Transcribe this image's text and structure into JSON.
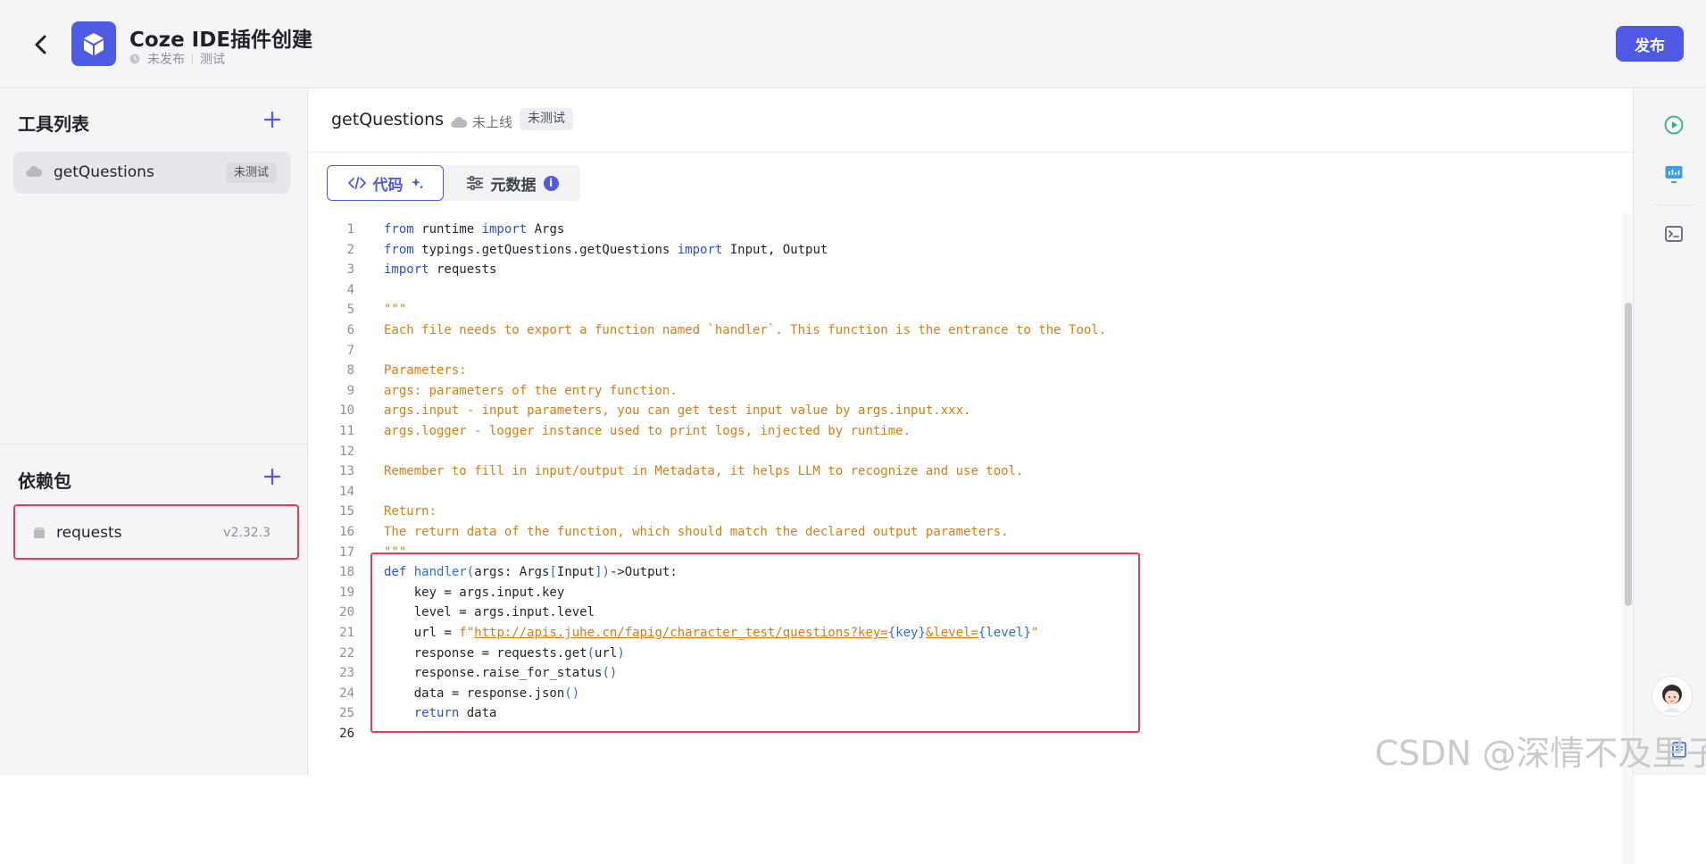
{
  "header": {
    "app_title": "Coze IDE插件创建",
    "status": "未发布",
    "mode": "测试",
    "publish_label": "发布"
  },
  "sidebar": {
    "tools_title": "工具列表",
    "tools": [
      {
        "name": "getQuestions",
        "badge": "未测试"
      }
    ],
    "deps_title": "依赖包",
    "deps": [
      {
        "name": "requests",
        "version": "v2.32.3"
      }
    ]
  },
  "editor": {
    "file_name": "getQuestions",
    "file_status": "未上线",
    "file_badge": "未测试",
    "tabs": {
      "code": "代码",
      "metadata": "元数据"
    },
    "lines": [
      {
        "n": "1",
        "parts": [
          {
            "t": "from",
            "c": "kw"
          },
          {
            "t": " runtime ",
            "c": ""
          },
          {
            "t": "import",
            "c": "kw"
          },
          {
            "t": " Args",
            "c": ""
          }
        ]
      },
      {
        "n": "2",
        "parts": [
          {
            "t": "from",
            "c": "kw"
          },
          {
            "t": " typings.getQuestions.getQuestions ",
            "c": ""
          },
          {
            "t": "import",
            "c": "kw"
          },
          {
            "t": " Input, Output",
            "c": ""
          }
        ]
      },
      {
        "n": "3",
        "parts": [
          {
            "t": "import",
            "c": "kw"
          },
          {
            "t": " requests",
            "c": ""
          }
        ]
      },
      {
        "n": "4",
        "parts": []
      },
      {
        "n": "5",
        "parts": [
          {
            "t": "\"\"\"",
            "c": "cm"
          }
        ]
      },
      {
        "n": "6",
        "parts": [
          {
            "t": "Each file needs to export a function named `handler`. This function is the entrance to the Tool.",
            "c": "cm"
          }
        ]
      },
      {
        "n": "7",
        "parts": []
      },
      {
        "n": "8",
        "parts": [
          {
            "t": "Parameters:",
            "c": "cm"
          }
        ]
      },
      {
        "n": "9",
        "parts": [
          {
            "t": "args: parameters of the entry function.",
            "c": "cm"
          }
        ]
      },
      {
        "n": "10",
        "parts": [
          {
            "t": "args.input - input parameters, you can get test input value by args.input.xxx.",
            "c": "cm"
          }
        ]
      },
      {
        "n": "11",
        "parts": [
          {
            "t": "args.logger - logger instance used to print logs, injected by runtime.",
            "c": "cm"
          }
        ]
      },
      {
        "n": "12",
        "parts": []
      },
      {
        "n": "13",
        "parts": [
          {
            "t": "Remember to fill in input/output in Metadata, it helps LLM to recognize and use tool.",
            "c": "cm"
          }
        ]
      },
      {
        "n": "14",
        "parts": []
      },
      {
        "n": "15",
        "parts": [
          {
            "t": "Return:",
            "c": "cm"
          }
        ]
      },
      {
        "n": "16",
        "parts": [
          {
            "t": "The return data of the function, which should match the declared output parameters.",
            "c": "cm"
          }
        ]
      },
      {
        "n": "17",
        "parts": [
          {
            "t": "\"\"\"",
            "c": "cm"
          }
        ]
      },
      {
        "n": "18",
        "parts": [
          {
            "t": "def",
            "c": "kw"
          },
          {
            "t": " ",
            "c": ""
          },
          {
            "t": "handler",
            "c": "fn"
          },
          {
            "t": "(",
            "c": "bracket"
          },
          {
            "t": "args: Args",
            "c": ""
          },
          {
            "t": "[",
            "c": "bracket"
          },
          {
            "t": "Input",
            "c": ""
          },
          {
            "t": "])",
            "c": "bracket"
          },
          {
            "t": "->Output:",
            "c": ""
          }
        ]
      },
      {
        "n": "19",
        "parts": [
          {
            "t": "    key = args.input.key",
            "c": ""
          }
        ]
      },
      {
        "n": "20",
        "parts": [
          {
            "t": "    level = args.input.level",
            "c": ""
          }
        ]
      },
      {
        "n": "21",
        "parts": [
          {
            "t": "    url = ",
            "c": ""
          },
          {
            "t": "f\"",
            "c": "cm"
          },
          {
            "t": "http://apis.juhe.cn/fapig/character_test/questions?key=",
            "c": "url"
          },
          {
            "t": "{key}",
            "c": "bracket"
          },
          {
            "t": "&level=",
            "c": "url"
          },
          {
            "t": "{level}",
            "c": "bracket"
          },
          {
            "t": "\"",
            "c": "cm"
          }
        ]
      },
      {
        "n": "22",
        "parts": [
          {
            "t": "    response = requests.get",
            "c": ""
          },
          {
            "t": "(",
            "c": "bracket"
          },
          {
            "t": "url",
            "c": ""
          },
          {
            "t": ")",
            "c": "bracket"
          }
        ]
      },
      {
        "n": "23",
        "parts": [
          {
            "t": "    response.raise_for_status",
            "c": ""
          },
          {
            "t": "()",
            "c": "bracket"
          }
        ]
      },
      {
        "n": "24",
        "parts": [
          {
            "t": "    data = response.json",
            "c": ""
          },
          {
            "t": "()",
            "c": "bracket"
          }
        ]
      },
      {
        "n": "25",
        "parts": [
          {
            "t": "    ",
            "c": ""
          },
          {
            "t": "return",
            "c": "kw"
          },
          {
            "t": " data",
            "c": ""
          }
        ]
      },
      {
        "n": "26",
        "parts": []
      }
    ],
    "active_line": "26"
  },
  "watermark": "CSDN @深情不及里子",
  "colors": {
    "accent": "#4f59e5",
    "highlight": "#e8395b",
    "comment": "#d97c12",
    "keyword": "#2b4fd6"
  }
}
